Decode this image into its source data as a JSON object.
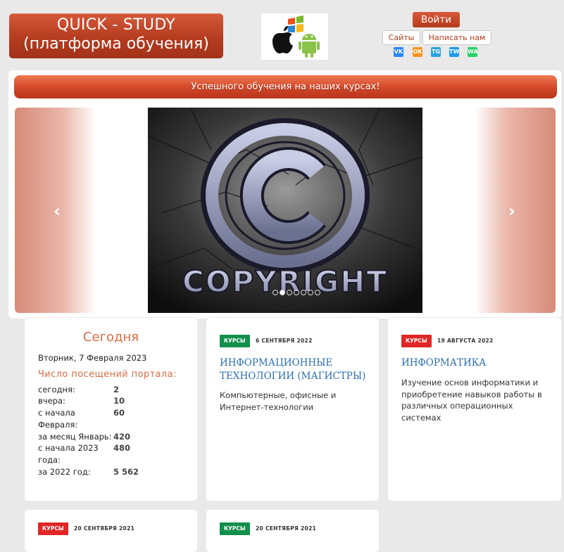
{
  "header": {
    "logo_title": "QUICK - STUDY",
    "logo_subtitle": "(платформа обучения)",
    "login_label": "Войти",
    "sites_label": "Сайты",
    "write_label": "Написать нам",
    "socials": [
      {
        "name": "vk-icon",
        "text": "VK",
        "color": "#2787f5"
      },
      {
        "name": "ok-icon",
        "text": "OK",
        "color": "#f7931e"
      },
      {
        "name": "telegram-icon",
        "text": "TG",
        "color": "#2aa3df"
      },
      {
        "name": "twitter-icon",
        "text": "TW",
        "color": "#1d9bf0"
      },
      {
        "name": "whatsapp-icon",
        "text": "WA",
        "color": "#25d366"
      }
    ]
  },
  "banner": {
    "text": "Успешного обучения на наших курсах!"
  },
  "carousel": {
    "slide_text": "COPYRIGHT",
    "slide_count": 7,
    "active_index": 1
  },
  "stats": {
    "title": "Сегодня",
    "date": "Вторник, 7 Февраля 2023",
    "subtitle": "Число посещений портала:",
    "rows": [
      {
        "label": "сегодня:",
        "value": "2"
      },
      {
        "label": "вчера:",
        "value": "10"
      },
      {
        "label": "с начала Февраля:",
        "value": "60"
      },
      {
        "label": "за месяц Январь:",
        "value": "420"
      },
      {
        "label": "с начала 2023 года:",
        "value": "480"
      },
      {
        "label": "за 2022 год:",
        "value": "5 562"
      }
    ]
  },
  "courses": [
    {
      "badge": "КУРСЫ",
      "badge_color": "#12904b",
      "date": "6 СЕНТЯБРЯ 2022",
      "title": "Информационные технологии (магистры)",
      "desc": "Компьютерные, офисные и Интернет-технологии"
    },
    {
      "badge": "КУРСЫ",
      "badge_color": "#e02626",
      "date": "19 АВГУСТА 2022",
      "title": "Информатика",
      "desc": "Изучение основ информатики и приобретение навыков работы в различных операционных системах"
    },
    {
      "badge": "КУРСЫ",
      "badge_color": "#e02626",
      "date": "20 СЕНТЯБРЯ 2021"
    },
    {
      "badge": "КУРСЫ",
      "badge_color": "#12904b",
      "date": "20 СЕНТЯБРЯ 2021"
    }
  ]
}
